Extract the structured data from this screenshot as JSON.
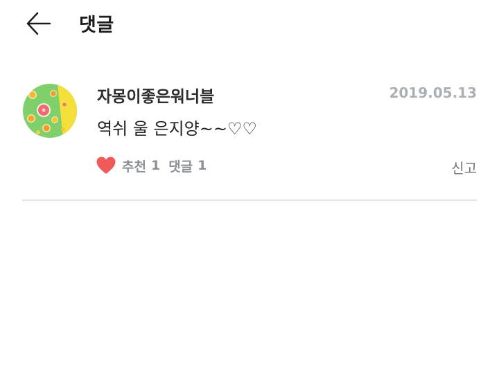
{
  "header": {
    "title": "댓글",
    "back_icon": "arrow-left-icon"
  },
  "comment": {
    "author": "자몽이좋은워너블",
    "date": "2019.05.13",
    "text": "역쉬 울 은지양~~♡♡",
    "avatar_icon": "fruit-slices-avatar",
    "like": {
      "icon": "heart-icon",
      "color": "#f05a5a",
      "label": "추천",
      "count": "1"
    },
    "reply": {
      "label": "댓글",
      "count": "1"
    },
    "report_label": "신고"
  }
}
